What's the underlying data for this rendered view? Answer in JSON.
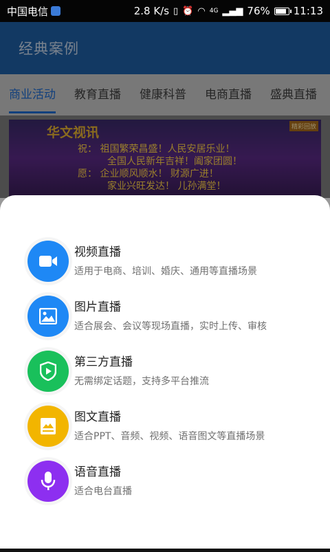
{
  "status_bar": {
    "carrier": "中国电信",
    "speed": "2.8 K/s",
    "network": "4G",
    "battery": "76%",
    "battery_level": 0.76,
    "time": "11:13"
  },
  "header": {
    "title": "经典案例"
  },
  "tabs": [
    {
      "label": "商业活动",
      "active": true
    },
    {
      "label": "教育直播",
      "active": false
    },
    {
      "label": "健康科普",
      "active": false
    },
    {
      "label": "电商直播",
      "active": false
    },
    {
      "label": "盛典直播",
      "active": false
    }
  ],
  "banner": {
    "brand": "华文视讯",
    "badge": "精彩回放",
    "lines": [
      "祝：   祖国繁荣昌盛！人民安居乐业！",
      "全国人民新年吉祥！阖家团圆！",
      "愿：   企业顺风顺水！  财源广进！",
      "家业兴旺发达！   儿孙满堂！"
    ]
  },
  "sheet": {
    "options": [
      {
        "title": "视频直播",
        "desc": "适用于电商、培训、婚庆、通用等直播场景",
        "color": "#1e88f5",
        "icon": "video-camera-icon"
      },
      {
        "title": "图片直播",
        "desc": "适合展会、会议等现场直播，实时上传、审核",
        "color": "#1e88f5",
        "icon": "image-icon"
      },
      {
        "title": "第三方直播",
        "desc": "无需绑定话题，支持多平台推流",
        "color": "#19c05b",
        "icon": "shield-play-icon"
      },
      {
        "title": "图文直播",
        "desc": "适合PPT、音频、视频、语音图文等直播场景",
        "color": "#f2b500",
        "icon": "picture-text-icon"
      },
      {
        "title": "语音直播",
        "desc": "适合电台直播",
        "color": "#8d2ff0",
        "icon": "microphone-icon"
      }
    ]
  }
}
